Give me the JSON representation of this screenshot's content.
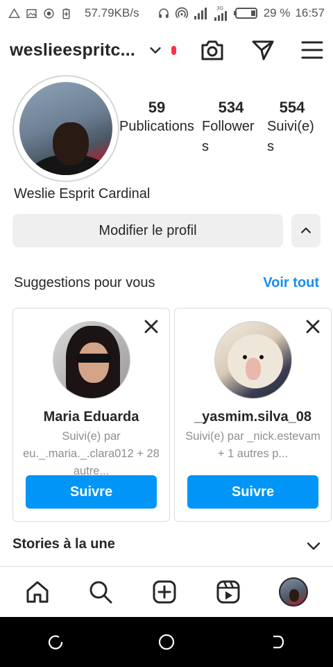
{
  "status_bar": {
    "network_speed": "57.79KB/s",
    "network_type": "3G",
    "battery_percent": "29 %",
    "time": "16:57",
    "icons": [
      "warning-icon",
      "image-icon",
      "record-icon",
      "battery-saver-icon",
      "headphones-icon",
      "hotspot-icon",
      "signal-icon",
      "signal-3g-icon",
      "battery-icon"
    ]
  },
  "header": {
    "username": "weslieespritc...",
    "icons": [
      "chevron-down-icon",
      "camera-icon",
      "direct-message-icon",
      "menu-icon"
    ],
    "notification_dot_color": "#ff3040"
  },
  "profile": {
    "full_name": "Weslie Esprit Cardinal",
    "stats": [
      {
        "value": "59",
        "label": "Publications"
      },
      {
        "value": "534",
        "label": "Followers"
      },
      {
        "value": "554",
        "label": "Suivi(e)s"
      }
    ],
    "edit_profile_label": "Modifier le profil"
  },
  "suggestions": {
    "title": "Suggestions pour vous",
    "see_all_label": "Voir tout",
    "cards": [
      {
        "name": "Maria Eduarda",
        "subtitle": "Suivi(e) par eu._.maria._.clara012 + 28 autre...",
        "follow_label": "Suivre"
      },
      {
        "name": "_yasmim.silva_08",
        "subtitle": "Suivi(e) par _nick.estevam + 1 autres p...",
        "follow_label": "Suivre"
      }
    ]
  },
  "stories": {
    "title": "Stories à la une"
  },
  "bottom_nav": {
    "items": [
      "home-icon",
      "search-icon",
      "create-icon",
      "reels-icon",
      "profile-avatar"
    ]
  },
  "system_nav": {
    "items": [
      "recents-icon",
      "home-circle-icon",
      "back-icon"
    ]
  },
  "colors": {
    "accent": "#0095f6",
    "link": "#1a8cef",
    "text": "#262626",
    "muted": "#8e8e8e",
    "button_bg": "#efefef"
  }
}
